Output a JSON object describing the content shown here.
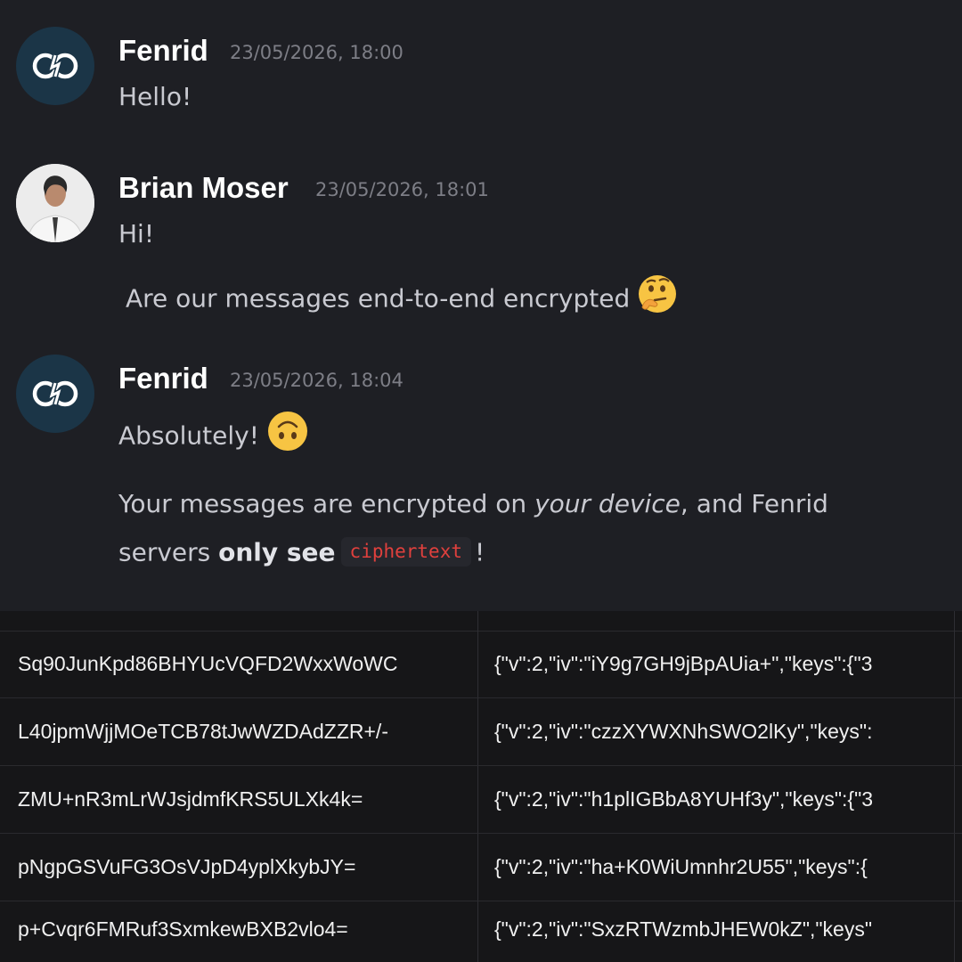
{
  "messages": [
    {
      "author": "Fenrid",
      "timestamp": "23/05/2026, 18:00",
      "avatar": "fenrid-logo",
      "lines": [
        "Hello!"
      ]
    },
    {
      "author": "Brian Moser",
      "timestamp": "23/05/2026, 18:01",
      "avatar": "user-photo",
      "lines": [
        "Hi!",
        "Are our messages end-to-end encrypted"
      ],
      "emoji": "thinking-face"
    },
    {
      "author": "Fenrid",
      "timestamp": "23/05/2026, 18:04",
      "avatar": "fenrid-logo",
      "line1": "Absolutely!",
      "line1_emoji": "upside-down-face",
      "para": {
        "part1": "Your messages are encrypted on ",
        "part2_italic": "your device",
        "part3": ", and Fenrid",
        "part4": "servers ",
        "part5_bold": "only see",
        "code": "ciphertext",
        "part6": "!"
      }
    }
  ],
  "table": {
    "rows": [
      {
        "id": "Sq90JunKpd86BHYUcVQFD2WxxWoWC",
        "payload": "{\"v\":2,\"iv\":\"iY9g7GH9jBpAUia+\",\"keys\":{\"3"
      },
      {
        "id": "L40jpmWjjMOeTCB78tJwWZDAdZZR+/-",
        "payload": "{\"v\":2,\"iv\":\"czzXYWXNhSWO2lKy\",\"keys\":"
      },
      {
        "id": "ZMU+nR3mLrWJsjdmfKRS5ULXk4k=",
        "payload": "{\"v\":2,\"iv\":\"h1plIGBbA8YUHf3y\",\"keys\":{\"3"
      },
      {
        "id": "pNgpGSVuFG3OsVJpD4yplXkybJY=",
        "payload": "{\"v\":2,\"iv\":\"ha+K0WiUmnhr2U55\",\"keys\":{"
      },
      {
        "id": "p+Cvqr6FMRuf3SxmkewBXB2vlo4=",
        "payload": "{\"v\":2,\"iv\":\"SxzRTWzmbJHEW0kZ\",\"keys\""
      }
    ]
  },
  "colors": {
    "background": "#1e1f24",
    "code_text": "#e0403d",
    "table_background": "#161618"
  }
}
